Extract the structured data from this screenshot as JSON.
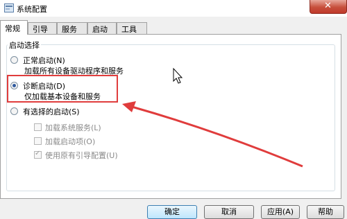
{
  "window": {
    "title": "系统配置",
    "close_glyph": "✕"
  },
  "tabs": [
    {
      "label": "常规",
      "active": true
    },
    {
      "label": "引导",
      "active": false
    },
    {
      "label": "服务",
      "active": false
    },
    {
      "label": "启动",
      "active": false
    },
    {
      "label": "工具",
      "active": false
    }
  ],
  "startup_group": {
    "legend": "启动选择",
    "options": [
      {
        "label": "正常启动(N)",
        "description": "加载所有设备驱动程序和服务",
        "checked": false
      },
      {
        "label": "诊断启动(D)",
        "description": "仅加载基本设备和服务",
        "checked": true
      },
      {
        "label": "有选择的启动(S)",
        "checked": false
      }
    ],
    "selective_options": [
      {
        "label": "加载系统服务(L)",
        "checked": false
      },
      {
        "label": "加载启动项(O)",
        "checked": false
      },
      {
        "label": "使用原有引导配置(U)",
        "checked": true
      }
    ]
  },
  "buttons": {
    "ok": "确定",
    "cancel": "取消",
    "apply": "应用(A)",
    "help": "帮助"
  },
  "annotation": {
    "highlight_color": "#e03c3c",
    "arrow_color": "#e03c3c"
  },
  "icons": {
    "window": "settings-window-icon",
    "cursor": "mouse-pointer-icon"
  }
}
